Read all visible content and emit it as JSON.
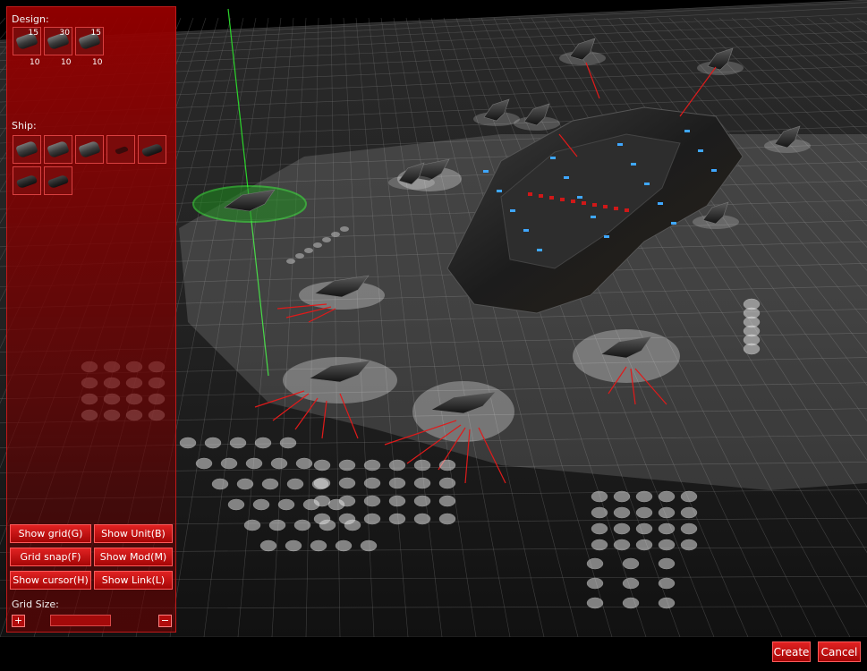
{
  "panel": {
    "design_label": "Design:",
    "ship_label": "Ship:",
    "grid_size_label": "Grid Size:",
    "design_slots": [
      {
        "top": "15",
        "bottom": "10"
      },
      {
        "top": "30",
        "bottom": "10"
      },
      {
        "top": "15",
        "bottom": "10"
      }
    ],
    "ship_slot_count": 7,
    "buttons": {
      "show_grid": "Show grid(G)",
      "show_unit": "Show Unit(B)",
      "grid_snap": "Grid snap(F)",
      "show_mod": "Show Mod(M)",
      "show_cursor": "Show cursor(H)",
      "show_link": "Show Link(L)",
      "grid_plus": "+",
      "grid_minus": "−"
    }
  },
  "footer": {
    "create": "Create",
    "cancel": "Cancel"
  },
  "colors": {
    "panel_red": "#960000",
    "button_red": "#d01414",
    "selection_green": "#28e028",
    "link_red": "#e01a1a"
  }
}
